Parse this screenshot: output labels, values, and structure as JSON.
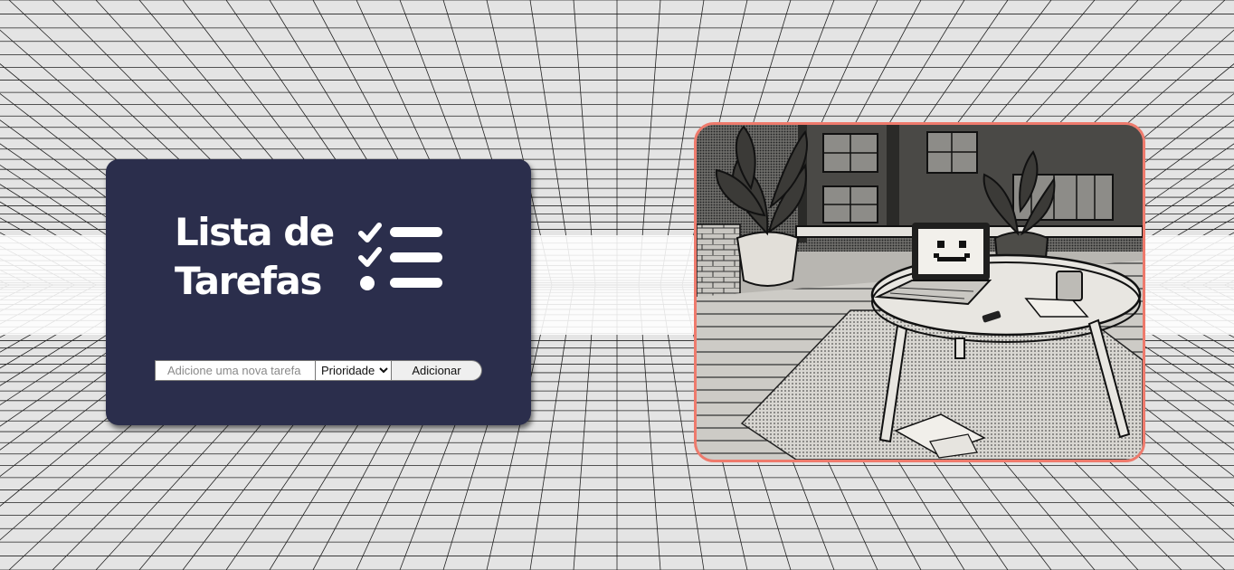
{
  "card": {
    "title_line1": "Lista de",
    "title_line2": "Tarefas",
    "icon": "checklist-icon"
  },
  "form": {
    "task_input": {
      "value": "",
      "placeholder": "Adicione uma nova tarefa"
    },
    "priority_select": {
      "selected": "Prioridade"
    },
    "add_button_label": "Adicionar"
  },
  "illustration": {
    "icon": "desk-laptop-illustration",
    "laptop_face": ":-)"
  },
  "colors": {
    "card_bg": "#2b2e4c",
    "accent_border": "#ee7a6c",
    "background": "#e4e4e4"
  }
}
